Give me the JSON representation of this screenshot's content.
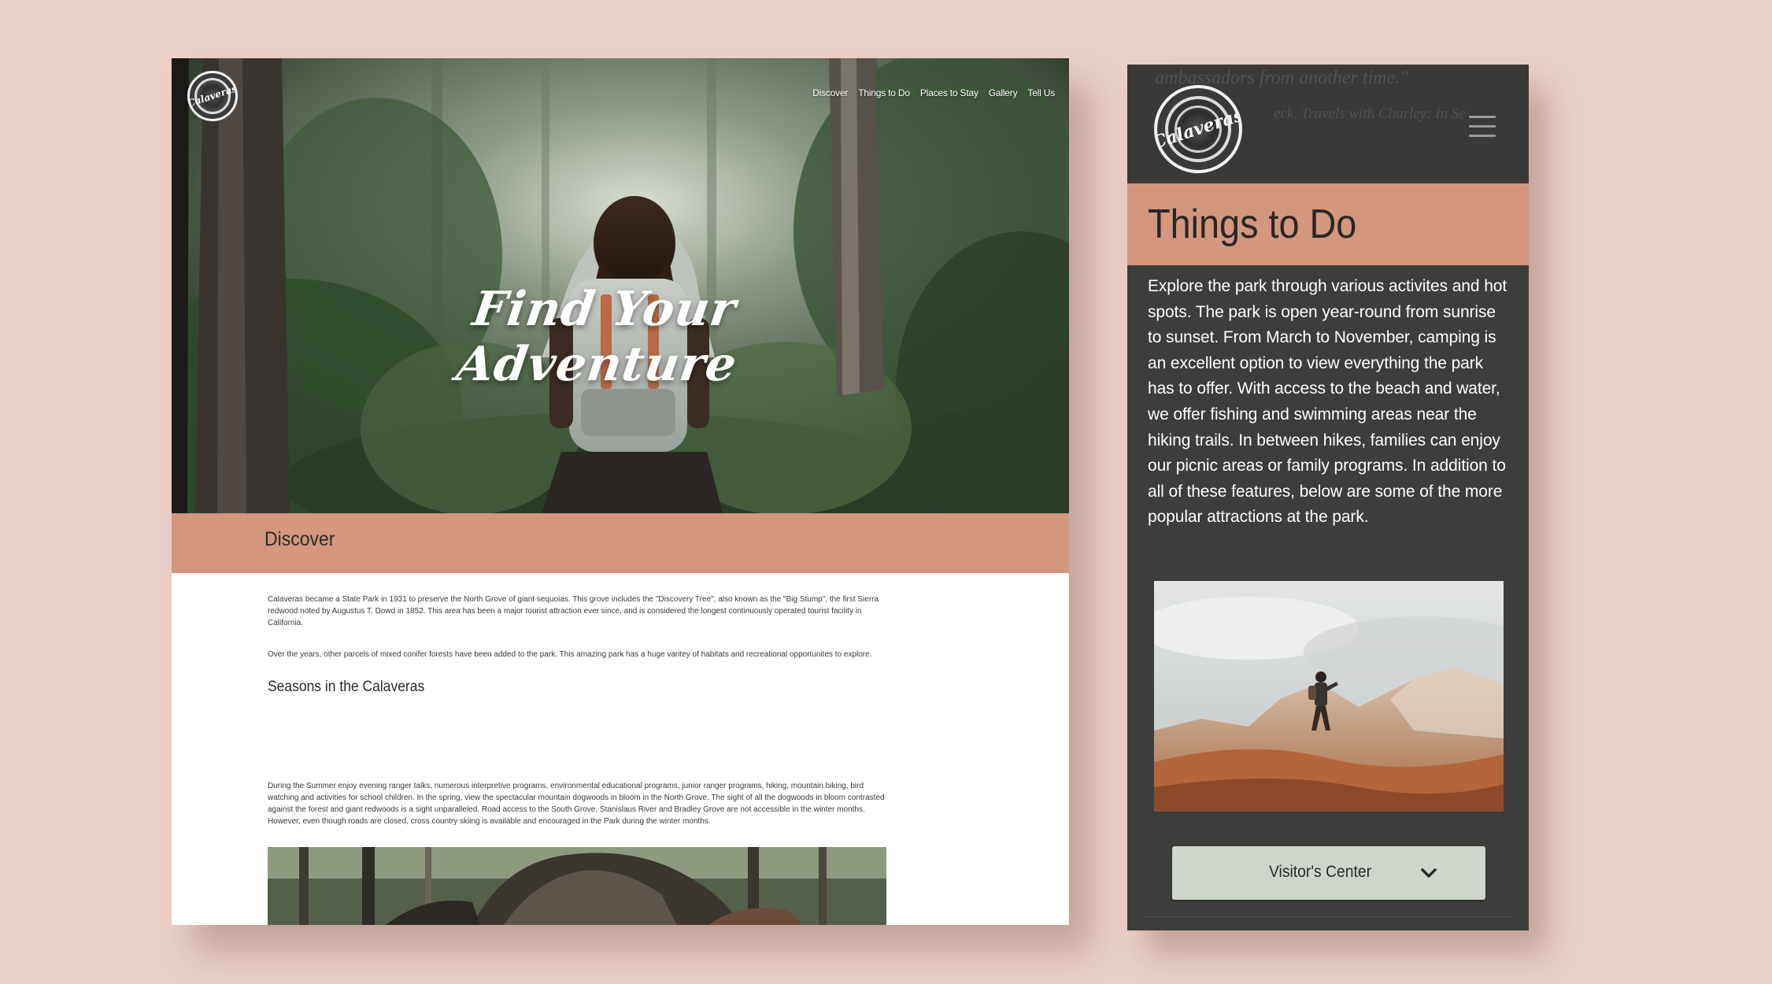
{
  "colors": {
    "page_background": "#ecd0c8",
    "accent_band": "#d3977d",
    "mobile_background": "#3d3d3b",
    "button_background": "#ced6cc"
  },
  "desktop": {
    "logo": {
      "text": "Calaveras"
    },
    "nav": [
      "Discover",
      "Things to Do",
      "Places to Stay",
      "Gallery",
      "Tell Us"
    ],
    "hero": {
      "title_line1": "Find Your",
      "title_line2": "Adventure"
    },
    "section_title": "Discover",
    "paragraph_1": "Calaveras became a State Park in 1931 to preserve the North Grove of giant sequoias. This grove includes the \"Discovery Tree\", also known as the \"Big Stump\", the first Sierra redwood noted by Augustus T. Dowd in 1852. This area has been a major tourist attraction ever since, and is considered the longest continuously operated tourist facility in California.",
    "paragraph_2": "Over the years, other parcels of mixed conifer forests have been added to the park. This amazing park has a huge varitey of habitats and recreational opportunites to explore.",
    "seasons_heading": "Seasons in the Calaveras",
    "paragraph_3": "During the Summer enjoy evening ranger talks, numerous interpretive programs, environmental educational programs, junior ranger programs, hiking, mountain biking, bird watching and activities for school children. In the spring, view the spectacular mountain dogwoods in bloom in the North Grove. The sight of all the dogwoods in bloom contrasted against the forest and giant redwoods is a sight unparalleled. Road access to the South Grove, Stanislaus River and Bradley Grove are not accessible in the winter months. However, even though roads are closed, cross country skiing is available and encouraged in the Park during the winter months."
  },
  "mobile": {
    "logo": {
      "text": "Calaveras"
    },
    "ghost_quote": "ambassadors from another time.\"",
    "ghost_attribution": "eck, Travels with Charley: In Se",
    "menu_icon": "hamburger-icon",
    "section_title": "Things to Do",
    "body_text": "Explore the park through various activites and hot spots. The park is open year-round from sunrise to sunset. From March to November, camping is an excellent option to view everything the park has to offer. With access to the beach and water, we offer fishing and swimming areas near the hiking trails. In between hikes, families can enjoy our picnic areas or family programs. In addition to all of these features, below are some of the more popular attractions at the park.",
    "dropdown": {
      "label": "Visitor's Center",
      "icon": "chevron-down-icon"
    }
  }
}
